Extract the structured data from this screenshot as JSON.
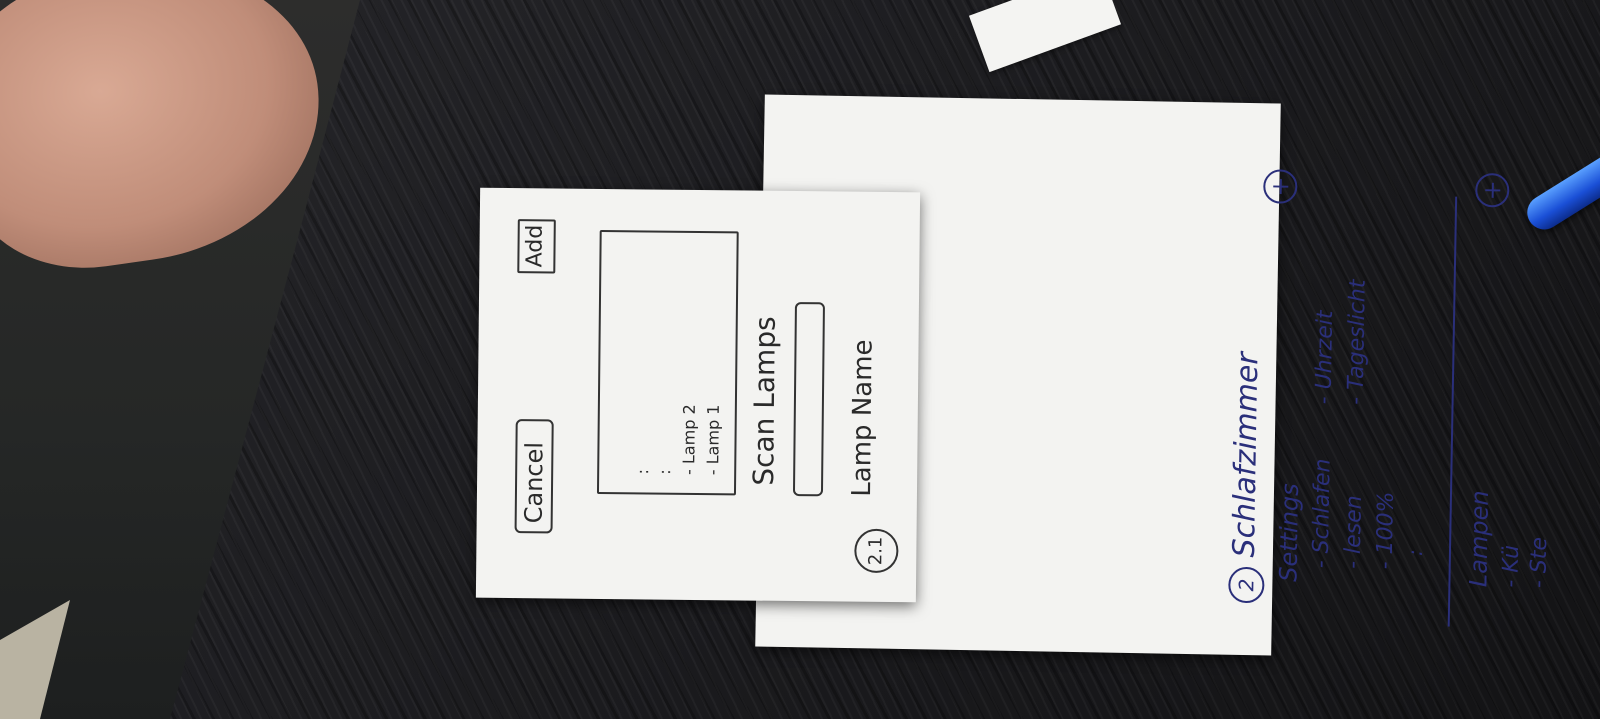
{
  "back_note": {
    "step": "2",
    "title": "Schlafzimmer",
    "settings_label": "Settings",
    "settings_items": [
      "- Schlafen",
      "- lesen",
      "- 100%",
      ":"
    ],
    "settings_items_right": [
      "- Uhrzeit",
      "- Tageslicht"
    ],
    "plus": "+",
    "lamps_label": "Lampen",
    "lamp_items": [
      "- Kü",
      "- Ste"
    ],
    "lamps_plus": "+"
  },
  "front_note": {
    "step": "2.1",
    "lamp_name_label": "Lamp Name",
    "scan_label": "Scan Lamps",
    "scan_items": [
      "- Lamp 1",
      "- Lamp 2",
      ":",
      ":"
    ],
    "cancel_label": "Cancel",
    "add_label": "Add"
  }
}
